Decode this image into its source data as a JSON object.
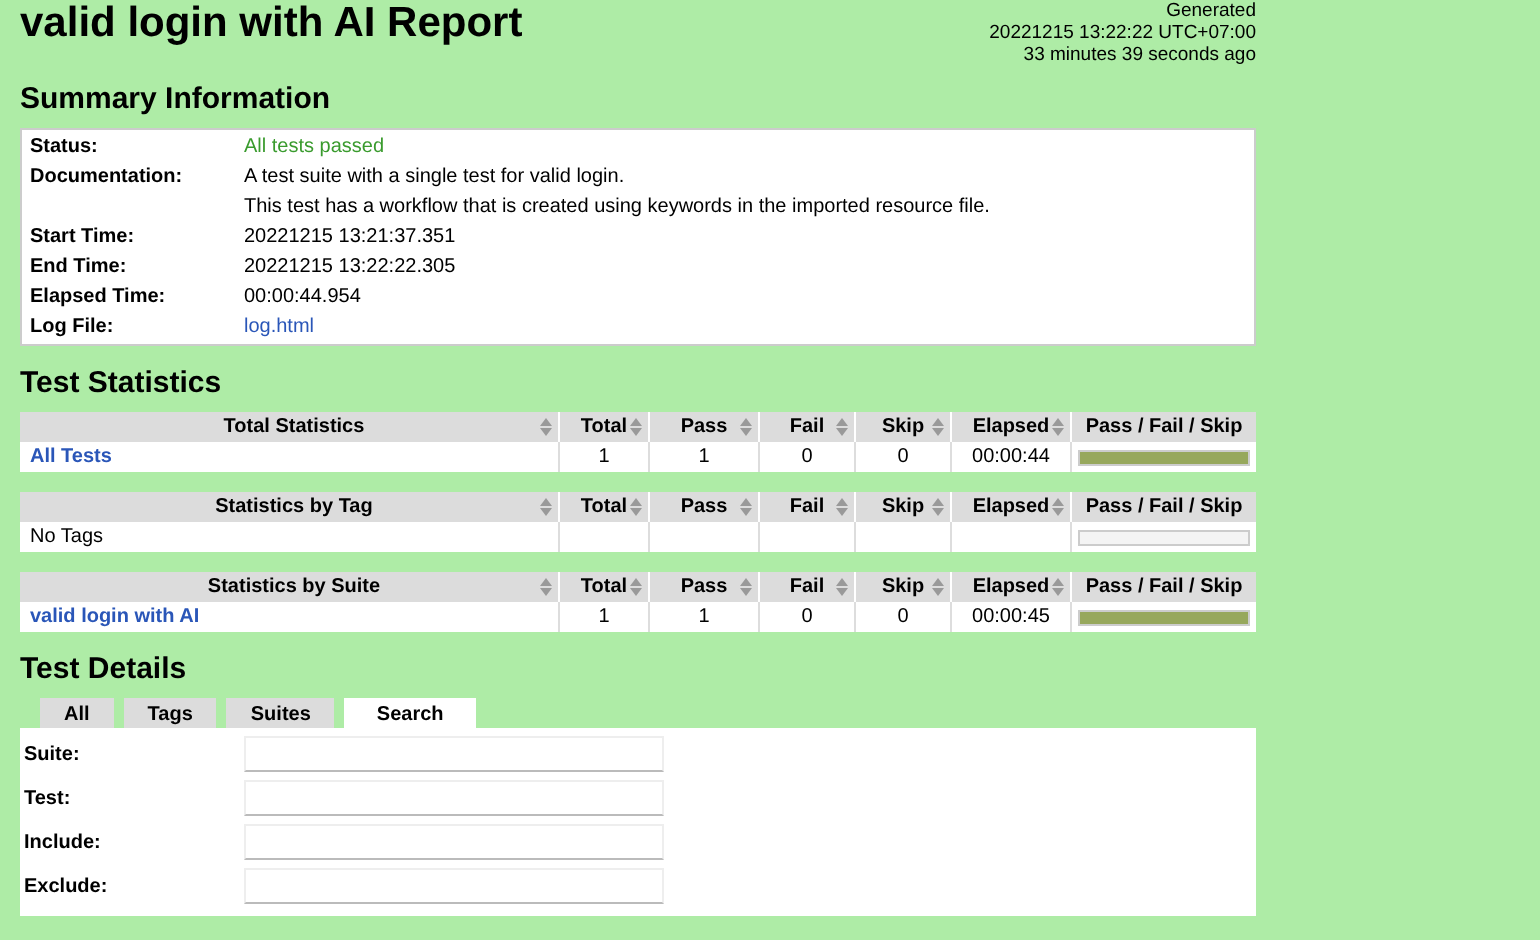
{
  "header": {
    "title": "valid login with AI Report",
    "generated": [
      "Generated",
      "20221215 13:22:22 UTC+07:00",
      "33 minutes 39 seconds ago"
    ]
  },
  "summary": {
    "heading": "Summary Information",
    "rows": [
      {
        "label": "Status:",
        "values": [
          "All tests passed"
        ],
        "kind": "pass"
      },
      {
        "label": "Documentation:",
        "values": [
          "A test suite with a single test for valid login.",
          "This test has a workflow that is created using keywords in the imported resource file."
        ],
        "kind": "text"
      },
      {
        "label": "Start Time:",
        "values": [
          "20221215 13:21:37.351"
        ],
        "kind": "text"
      },
      {
        "label": "End Time:",
        "values": [
          "20221215 13:22:22.305"
        ],
        "kind": "text"
      },
      {
        "label": "Elapsed Time:",
        "values": [
          "00:00:44.954"
        ],
        "kind": "text"
      },
      {
        "label": "Log File:",
        "values": [
          "log.html"
        ],
        "kind": "link"
      }
    ]
  },
  "statistics": {
    "heading": "Test Statistics",
    "tables": [
      {
        "columns": [
          "Total Statistics",
          "Total",
          "Pass",
          "Fail",
          "Skip",
          "Elapsed",
          "Pass / Fail / Skip"
        ],
        "rows": [
          {
            "kind": "link",
            "cells": [
              "All Tests",
              "1",
              "1",
              "0",
              "0",
              "00:00:44"
            ],
            "level": 1
          }
        ]
      },
      {
        "columns": [
          "Statistics by Tag",
          "Total",
          "Pass",
          "Fail",
          "Skip",
          "Elapsed",
          "Pass / Fail / Skip"
        ],
        "rows": [
          {
            "kind": "text",
            "cells": [
              "No Tags"
            ]
          }
        ]
      },
      {
        "columns": [
          "Statistics by Suite",
          "Total",
          "Pass",
          "Fail",
          "Skip",
          "Elapsed",
          "Pass / Fail / Skip"
        ],
        "rows": [
          {
            "kind": "link",
            "cells": [
              "valid login with AI",
              "1",
              "1",
              "0",
              "0",
              "00:00:45"
            ],
            "level": 1
          }
        ]
      }
    ]
  },
  "details": {
    "heading": "Test Details",
    "tabs": [
      {
        "label": "All",
        "selected": false
      },
      {
        "label": "Tags",
        "selected": false
      },
      {
        "label": "Suites",
        "selected": false
      },
      {
        "label": "Search",
        "selected": true
      }
    ],
    "fields": [
      {
        "label": "Suite:"
      },
      {
        "label": "Test:"
      },
      {
        "label": "Include:"
      },
      {
        "label": "Exclude:"
      }
    ]
  }
}
